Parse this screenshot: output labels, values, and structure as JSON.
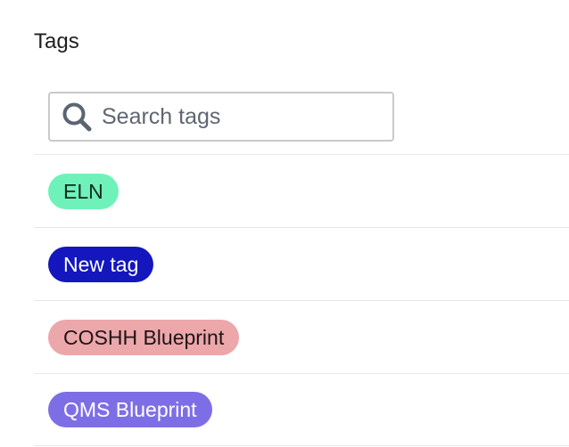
{
  "page": {
    "title": "Tags"
  },
  "search": {
    "placeholder": "Search tags",
    "value": "",
    "icon": "search-icon"
  },
  "tags": [
    {
      "label": "ELN",
      "background": "#6ff2b9",
      "text_color": "#0f2a1e"
    },
    {
      "label": "New tag",
      "background": "#1317bd",
      "text_color": "#ffffff"
    },
    {
      "label": "COSHH Blueprint",
      "background": "#eca7aa",
      "text_color": "#1f1416"
    },
    {
      "label": "QMS Blueprint",
      "background": "#7e6ee6",
      "text_color": "#ffffff"
    }
  ]
}
